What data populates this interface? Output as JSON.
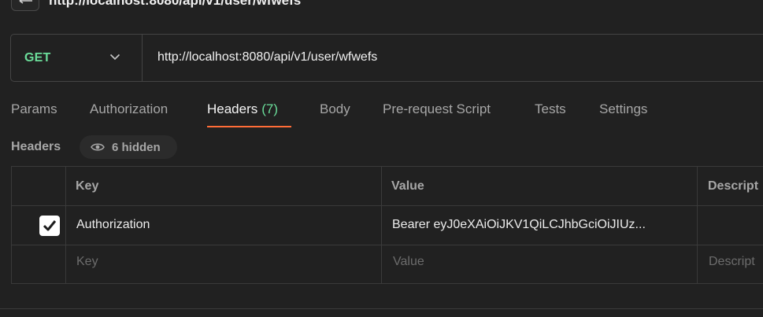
{
  "page": {
    "title": "http://localhost:8080/api/v1/user/wfwefs"
  },
  "request": {
    "method": "GET",
    "url": "http://localhost:8080/api/v1/user/wfwefs"
  },
  "tabs": [
    {
      "label": "Params"
    },
    {
      "label": "Authorization"
    },
    {
      "label": "Headers",
      "count": "(7)",
      "active": true
    },
    {
      "label": "Body"
    },
    {
      "label": "Pre-request Script"
    },
    {
      "label": "Tests"
    },
    {
      "label": "Settings"
    }
  ],
  "headers_section": {
    "label": "Headers",
    "hidden_text": "6 hidden"
  },
  "table": {
    "columns": [
      "Key",
      "Value",
      "Descript"
    ],
    "rows": [
      {
        "checked": true,
        "key": "Authorization",
        "value": "Bearer eyJ0eXAiOiJKV1QiLCJhbGciOiJIUz..."
      }
    ],
    "placeholder": {
      "key": "Key",
      "value": "Value",
      "description": "Descript"
    }
  },
  "colors": {
    "accent_tab": "#ff6c37",
    "method_get": "#6bdd9a",
    "background": "#212121"
  },
  "icons": [
    "back-arrow-icon",
    "chevron-down-icon",
    "eye-icon",
    "checkmark-icon"
  ]
}
